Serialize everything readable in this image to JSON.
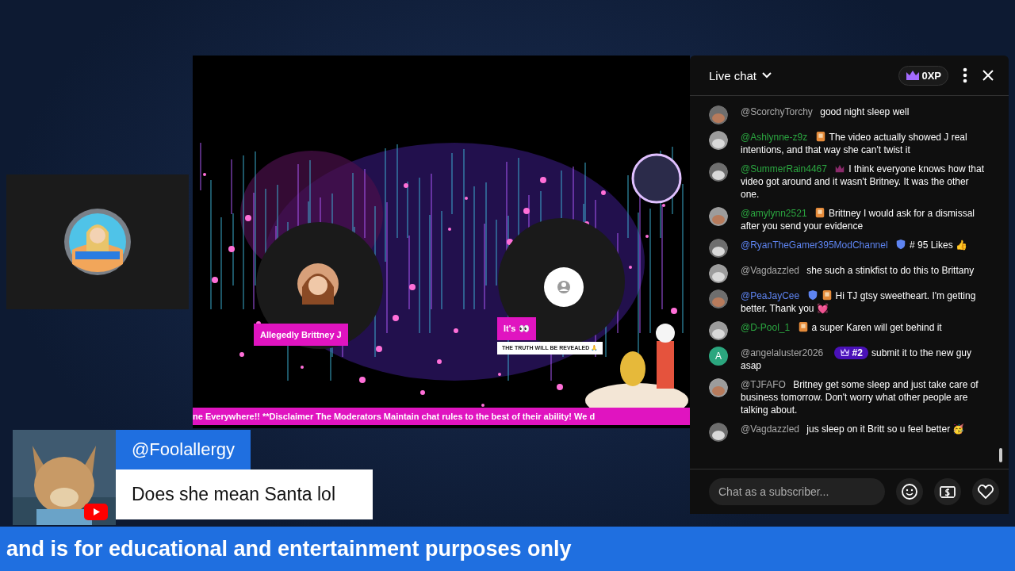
{
  "stage": {
    "kind": "picture",
    "participants": [
      {
        "name": "Allegedly Brittney J"
      },
      {
        "name": "It's 👀",
        "subtitle": "THE TRUTH WILL BE REVEALED 🙏"
      }
    ],
    "ticker": "ne Everywhere!! **Disclaimer The Moderators Maintain chat rules to the best of their ability! We d"
  },
  "chat": {
    "title": "Live chat",
    "xp": "0XP",
    "placeholder": "Chat as a subscriber...",
    "messages": [
      {
        "author": "@ScorchyTorchy",
        "color": "#aaaaaa",
        "text": "good night sleep well",
        "avatar": {
          "kind": "picture"
        }
      },
      {
        "author": "@Ashlynne-z9z",
        "color": "#2ba640",
        "badges": [
          {
            "kind": "member"
          }
        ],
        "text": "The video actually showed J real intentions, and that way she can't twist it",
        "avatar": {
          "kind": "picture"
        }
      },
      {
        "author": "@SummerRain4467",
        "color": "#2ba640",
        "badges": [
          {
            "kind": "crown"
          }
        ],
        "text": "I think everyone knows how that video got around and it wasn't Britney. It was the other one.",
        "avatar": {
          "kind": "picture"
        }
      },
      {
        "author": "@amylynn2521",
        "color": "#2ba640",
        "badges": [
          {
            "kind": "member"
          }
        ],
        "text": "Brittney I would ask for a dismissal after you send your evidence",
        "avatar": {
          "kind": "picture"
        }
      },
      {
        "author": "@RyanTheGamer395ModChannel",
        "color": "#5e84f1",
        "badges": [
          {
            "kind": "mod"
          }
        ],
        "text": "# 95 Likes 👍",
        "avatar": {
          "kind": "picture"
        }
      },
      {
        "author": "@Vagdazzled",
        "color": "#aaaaaa",
        "text": "she such a stinkfist to do this to Brittany",
        "avatar": {
          "kind": "picture"
        }
      },
      {
        "author": "@PeaJayCee",
        "color": "#5e84f1",
        "badges": [
          {
            "kind": "mod"
          },
          {
            "kind": "member"
          }
        ],
        "text": "Hi TJ gtsy sweetheart. I'm getting better. Thank you 💓",
        "avatar": {
          "kind": "picture"
        }
      },
      {
        "author": "@D-Pool_1",
        "color": "#2ba640",
        "badges": [
          {
            "kind": "member"
          }
        ],
        "text": "a super Karen will get behind it",
        "avatar": {
          "kind": "picture"
        }
      },
      {
        "author": "@angelaluster2026",
        "color": "#aaaaaa",
        "badges": [
          {
            "kind": "rank",
            "label": "#2"
          }
        ],
        "text": "submit it to the new guy asap",
        "avatar": {
          "kind": "letter",
          "letter": "A",
          "color": "#2ba67e"
        }
      },
      {
        "author": "@TJFAFO",
        "color": "#aaaaaa",
        "text": "Britney get some sleep and just take care of business tomorrow. Don't worry what other people are talking about.",
        "avatar": {
          "kind": "picture"
        }
      },
      {
        "author": "@Vagdazzled",
        "color": "#aaaaaa",
        "text": "jus sleep on it Britt so u feel better 🥳",
        "avatar": {
          "kind": "picture"
        }
      }
    ]
  },
  "comment": {
    "author": "@Foolallergy",
    "text": "Does she mean Santa lol"
  },
  "banner": "and is for educational and entertainment purposes only"
}
